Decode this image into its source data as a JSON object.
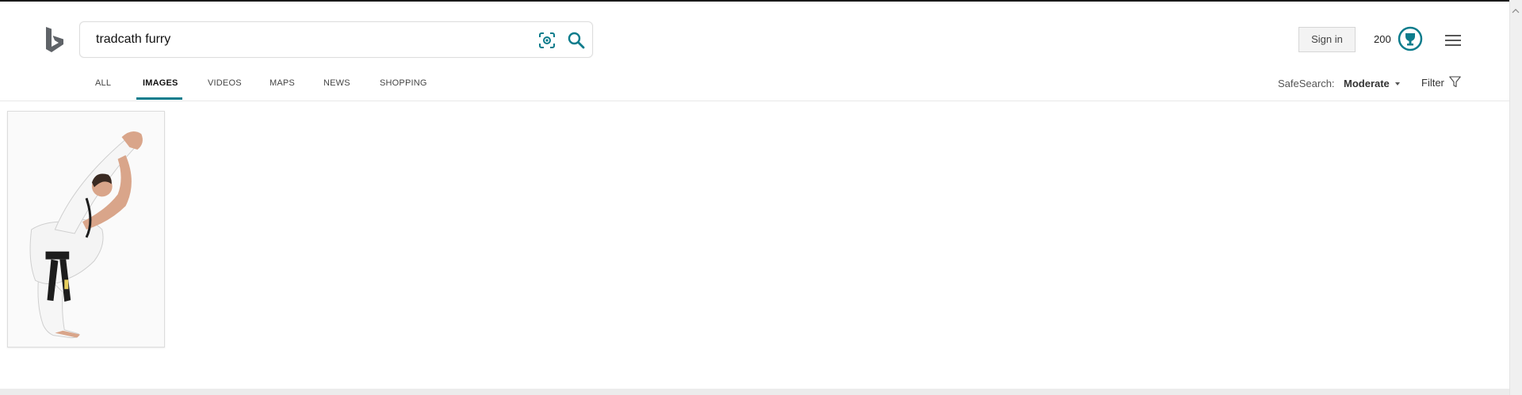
{
  "search": {
    "query": "tradcath furry"
  },
  "header": {
    "sign_in_label": "Sign in",
    "rewards_count": "200"
  },
  "tabs": [
    {
      "label": "ALL"
    },
    {
      "label": "IMAGES",
      "active": true
    },
    {
      "label": "VIDEOS"
    },
    {
      "label": "MAPS"
    },
    {
      "label": "NEWS"
    },
    {
      "label": "SHOPPING"
    }
  ],
  "filters": {
    "safesearch_label": "SafeSearch:",
    "safesearch_value": "Moderate",
    "filter_label": "Filter"
  },
  "colors": {
    "accent": "#0c7c8c",
    "logo": "#5f6368"
  },
  "icons": {
    "logo": "bing-logo",
    "visual_search": "visual-search-icon",
    "search": "search-icon",
    "rewards": "rewards-trophy-icon",
    "menu": "hamburger-menu-icon",
    "filter": "filter-funnel-icon"
  },
  "results": {
    "count": 1
  }
}
